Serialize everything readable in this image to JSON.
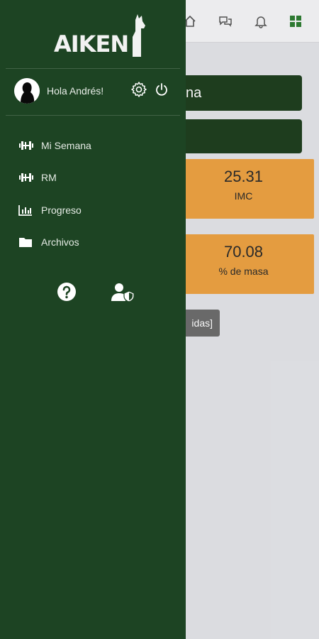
{
  "brand": {
    "logo_text": "AIKEN"
  },
  "user": {
    "greeting": "Hola Andrés!"
  },
  "menu": {
    "items": [
      {
        "label": "Mi Semana",
        "icon": "dumbbell-icon"
      },
      {
        "label": "RM",
        "icon": "dumbbell-icon"
      },
      {
        "label": "Progreso",
        "icon": "chart-icon"
      },
      {
        "label": "Archivos",
        "icon": "folder-icon"
      }
    ]
  },
  "background": {
    "header_partial": "na",
    "stats": [
      {
        "value": "25.31",
        "label": "IMC"
      },
      {
        "value": "70.08",
        "label": "% de masa"
      }
    ],
    "button_partial": "idas]"
  },
  "colors": {
    "drawer": "#1d4423",
    "accent_green": "#1f3f1f",
    "card_orange": "#eca243"
  }
}
